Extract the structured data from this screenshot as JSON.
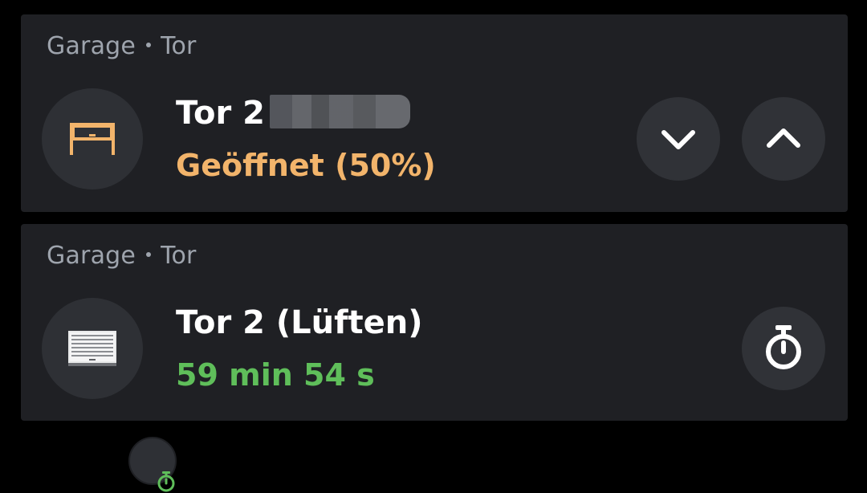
{
  "cards": [
    {
      "breadcrumb": {
        "room": "Garage",
        "type": "Tor"
      },
      "title": "Tor 2",
      "status": "Geöffnet (50%)",
      "status_color": "#f2b46b",
      "icon": "garage-door-open-icon",
      "actions": [
        {
          "icon": "chevron-down-icon"
        },
        {
          "icon": "chevron-up-icon"
        }
      ]
    },
    {
      "breadcrumb": {
        "room": "Garage",
        "type": "Tor"
      },
      "title": "Tor 2 (Lüften)",
      "status": "59 min 54 s",
      "status_color": "#5fbe5a",
      "icon": "garage-door-closed-icon",
      "badge_icon": "timer-icon",
      "actions": [
        {
          "icon": "timer-icon"
        }
      ]
    }
  ],
  "colors": {
    "background": "#000000",
    "card": "#1f2024",
    "button": "#303237",
    "secondary_text": "#9ea4ad"
  }
}
